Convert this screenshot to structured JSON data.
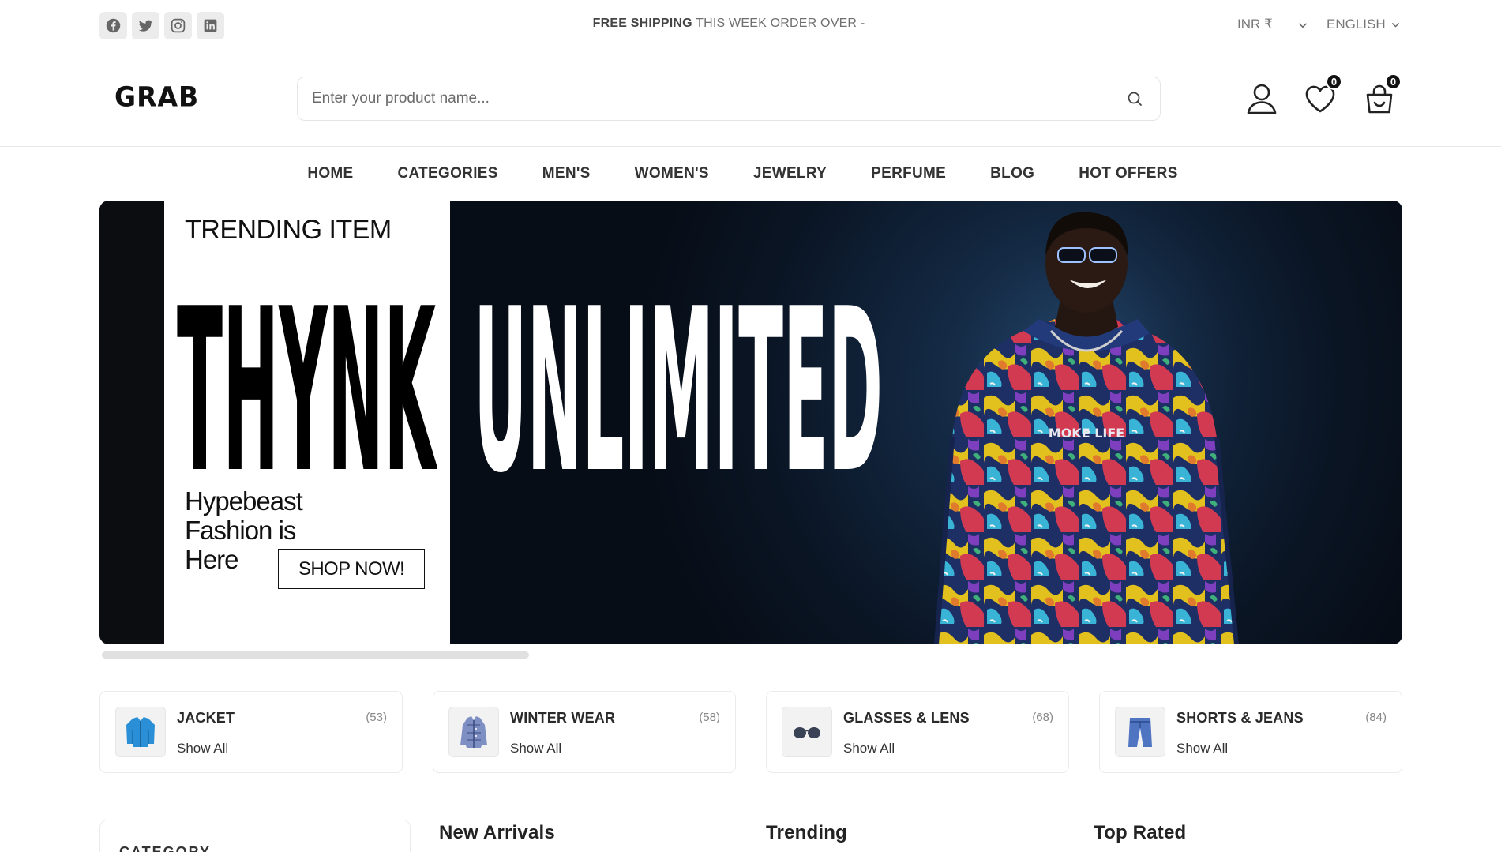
{
  "topbar": {
    "socials": [
      "facebook-icon",
      "twitter-icon",
      "instagram-icon",
      "linkedin-icon"
    ],
    "promo_bold": "FREE SHIPPING",
    "promo_text": " THIS WEEK ORDER OVER -",
    "currency": "INR ₹",
    "language": "ENGLISH"
  },
  "header": {
    "logo": "GRAB",
    "search_placeholder": "Enter your product name...",
    "wishlist_count": "0",
    "cart_count": "0"
  },
  "nav": {
    "items": [
      "HOME",
      "CATEGORIES",
      "MEN'S",
      "WOMEN'S",
      "JEWELRY",
      "PERFUME",
      "BLOG",
      "HOT OFFERS"
    ]
  },
  "hero": {
    "label": "TRENDING ITEM",
    "brand": "THYNK",
    "headline": "UNLIMITED",
    "subtitle": "Hypebeast Fashion is Here",
    "cta": "SHOP NOW!",
    "shirt_text": "MOKE LIFE"
  },
  "categories": [
    {
      "title": "JACKET",
      "count": "(53)",
      "link": "Show All",
      "icon": "jacket-icon"
    },
    {
      "title": "WINTER WEAR",
      "count": "(58)",
      "link": "Show All",
      "icon": "winter-coat-icon"
    },
    {
      "title": "GLASSES & LENS",
      "count": "(68)",
      "link": "Show All",
      "icon": "glasses-icon"
    },
    {
      "title": "SHORTS & JEANS",
      "count": "(84)",
      "link": "Show All",
      "icon": "jeans-icon"
    }
  ],
  "sections": {
    "sidebar_title": "CATEGORY",
    "new_arrivals": "New Arrivals",
    "trending": "Trending",
    "top_rated": "Top Rated"
  },
  "colors": {
    "accent": "#111111",
    "hero_bg": "#0a1524"
  }
}
